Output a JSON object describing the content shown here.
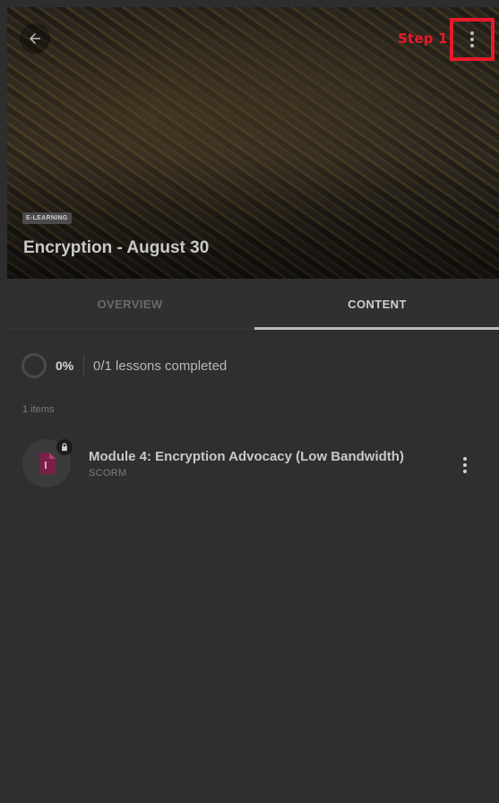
{
  "header": {
    "step_label": "Step 1",
    "badge": "E-LEARNING",
    "title": "Encryption - August 30",
    "icons": {
      "back": "arrow-left-icon",
      "more": "more-vertical-icon"
    }
  },
  "tabs": [
    {
      "label": "OVERVIEW",
      "active": false
    },
    {
      "label": "CONTENT",
      "active": true
    }
  ],
  "progress": {
    "percent_label": "0%",
    "percent_value": 0,
    "lessons_text": "0/1 lessons completed"
  },
  "items_count": "1 items",
  "lessons": [
    {
      "title": "Module 4: Encryption Advocacy (Low Bandwidth)",
      "type": "SCORM",
      "icon": "document-icon",
      "locked": true
    }
  ],
  "colors": {
    "accent_red": "#e8192c",
    "doc_icon": "#7a1f4a"
  }
}
